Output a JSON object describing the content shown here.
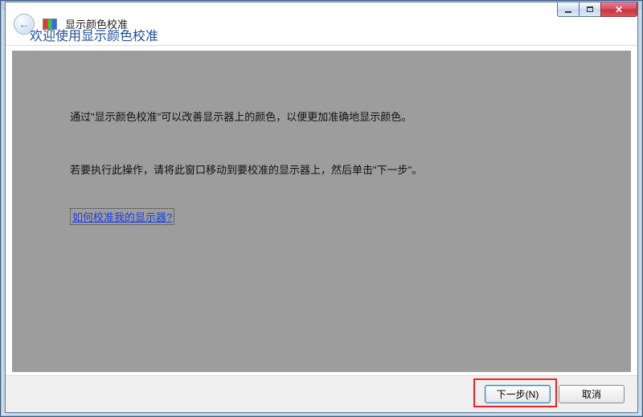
{
  "header": {
    "app_title": "显示颜色校准"
  },
  "content": {
    "heading": "欢迎使用显示颜色校准",
    "paragraph1": "通过\"显示颜色校准\"可以改善显示器上的颜色，以便更加准确地显示颜色。",
    "paragraph2": "若要执行此操作，请将此窗口移动到要校准的显示器上，然后单击\"下一步\"。",
    "help_link": "如何校准我的显示器?"
  },
  "footer": {
    "next_label": "下一步(N)",
    "cancel_label": "取消"
  },
  "titlebar": {
    "close_glyph": "✕"
  }
}
